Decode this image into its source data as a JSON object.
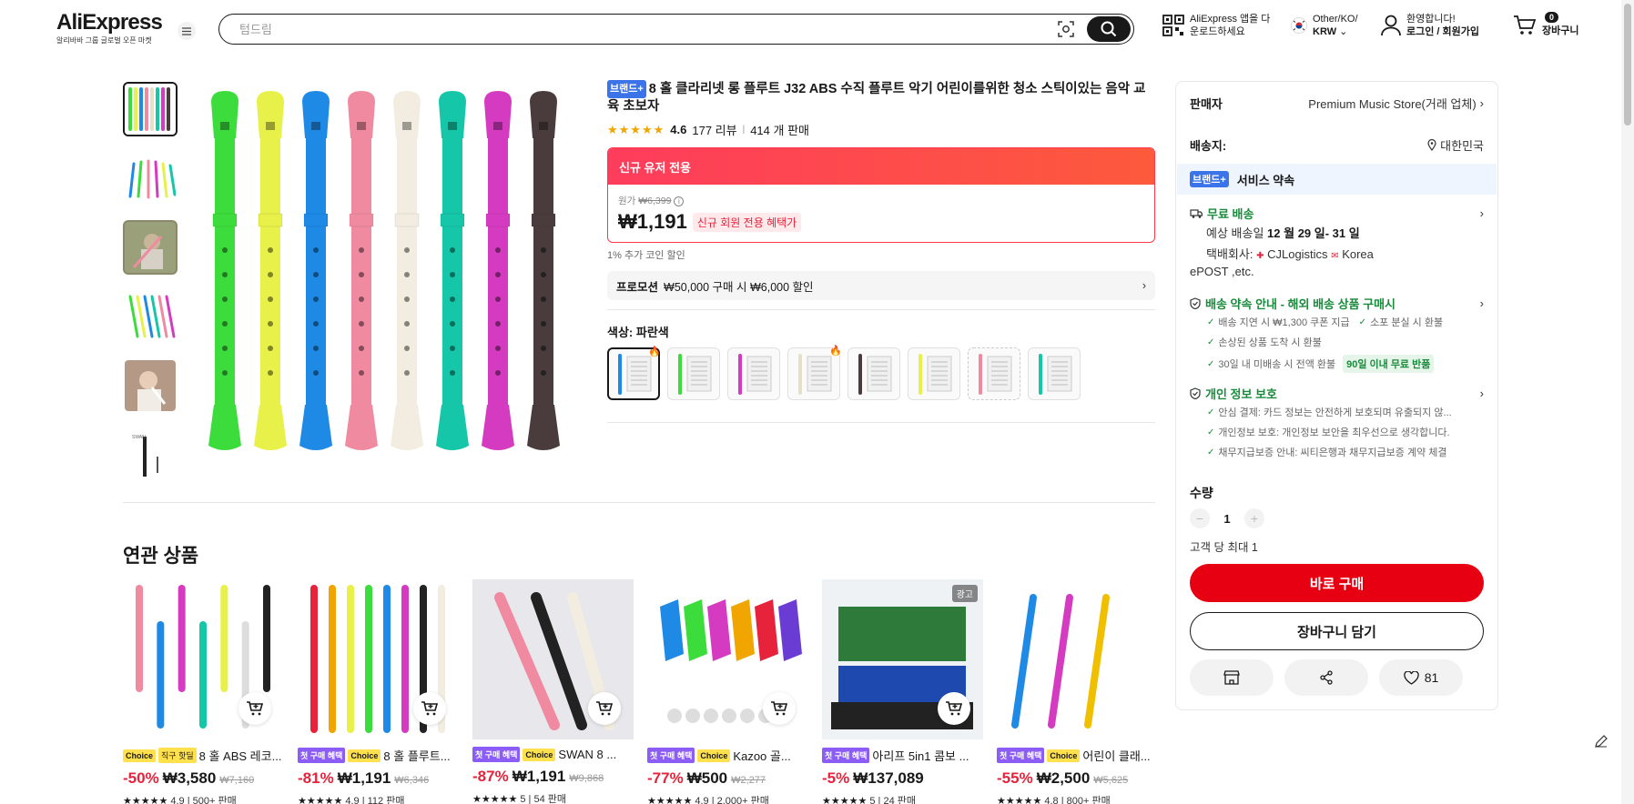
{
  "header": {
    "logo_text": "AliExpress",
    "tagline": "알리바바 그룹 글로벌 오픈 마켓",
    "search_placeholder": "텀드림",
    "app_line1": "AliExpress 앱을 다",
    "app_line2": "운로드하세요",
    "locale_line1": "Other/KO/",
    "locale_line2": "KRW",
    "account_line1": "환영합니다!",
    "account_line2": "로그인 / 회원가입",
    "cart_count": "0",
    "cart_label": "장바구니"
  },
  "product": {
    "brand_badge": "브랜드+",
    "title": "8 홀 클라리넷 롱 플루트 J32 ABS 수직 플루트 악기 어린이를위한 청소 스틱이있는 음악 교육 초보자",
    "stars": "★★★★★",
    "rating": "4.6",
    "reviews": "177 리뷰",
    "sold": "414 개 판매",
    "deal_header": "신규 유저 전용",
    "original_label": "원가",
    "original_price": "₩6,399",
    "price": "₩1,191",
    "price_tag": "신규 회원 전용 혜택가",
    "coin_text": "1% 추가 코인 할인",
    "promo_label": "프로모션",
    "promo_text": "₩50,000 구매 시 ₩6,000 할인",
    "color_label": "색상: 파란색"
  },
  "panel": {
    "seller_label": "판매자",
    "seller_value": "Premium Music Store(거래 업체)",
    "ship_to_label": "배송지:",
    "ship_to_value": "대한민국",
    "service_badge": "브랜드+",
    "service_title": "서비스 약속",
    "free_shipping": "무료 배송",
    "delivery_prefix": "예상 배송일",
    "delivery_dates": "12 월 29 일- 31 일",
    "carrier_label": "택배회사:",
    "carrier_1": "CJLogistics",
    "carrier_2": "Korea",
    "carrier_3": "ePOST ,etc.",
    "promise_title": "배송 약속 안내 - 해외 배송 상품 구매시",
    "promise_1": "배송 지연 시 ₩1,300 쿠폰 지급",
    "promise_2": "소포 분실 시 환불",
    "promise_3": "손상된 상품 도착 시 환불",
    "promise_4": "30일 내 미배송 시 전액 환불",
    "promise_tag": "90일 이내 무료 반품",
    "privacy_title": "개인 정보 보호",
    "privacy_1": "안심 결제: 카드 정보는 안전하게 보호되며 유출되지 않...",
    "privacy_2": "개인정보 보호: 개인정보 보안을 최우선으로 생각합니다.",
    "privacy_3": "채무지급보증 안내: 씨티은행과 채무지급보증 계약 체결",
    "qty_label": "수량",
    "qty_minus": "−",
    "qty_value": "1",
    "qty_plus": "+",
    "limit_text": "고객 당 최대 1",
    "buy_now": "바로 구매",
    "add_to_cart": "장바구니 담기",
    "wishlist_count": "81"
  },
  "related": {
    "title": "연관 상품",
    "items": [
      {
        "badges": [
          "Choice",
          "직구 핫딜"
        ],
        "name": "8 홀 ABS 레코...",
        "discount": "-50%",
        "price": "₩3,580",
        "orig": "₩7,160",
        "stars": "★★★★★",
        "rating": "4.9",
        "sold": "500+ 판매",
        "ad": ""
      },
      {
        "badges": [
          "첫 구매 혜택",
          "Choice"
        ],
        "name": "8 홀 플루트...",
        "discount": "-81%",
        "price": "₩1,191",
        "orig": "₩6,346",
        "stars": "★★★★★",
        "rating": "4.9",
        "sold": "112 판매",
        "ad": ""
      },
      {
        "badges": [
          "첫 구매 혜택",
          "Choice"
        ],
        "name": "SWAN 8 ...",
        "discount": "-87%",
        "price": "₩1,191",
        "orig": "₩9,868",
        "stars": "★★★★★",
        "rating": "5",
        "sold": "54 판매",
        "ad": ""
      },
      {
        "badges": [
          "첫 구매 혜택",
          "Choice"
        ],
        "name": "Kazoo 골...",
        "discount": "-77%",
        "price": "₩500",
        "orig": "₩2,277",
        "stars": "★★★★★",
        "rating": "4.9",
        "sold": "2,000+ 판매",
        "ad": ""
      },
      {
        "badges": [
          "첫 구매 혜택"
        ],
        "name": "아리프 5in1 콤보 ...",
        "discount": "-5%",
        "price": "₩137,089",
        "orig": "",
        "stars": "★★★★★",
        "rating": "5",
        "sold": "24 판매",
        "ad": "광고"
      },
      {
        "badges": [
          "첫 구매 혜택",
          "Choice"
        ],
        "name": "어린이 클래...",
        "discount": "-55%",
        "price": "₩2,500",
        "orig": "₩5,625",
        "stars": "★★★★★",
        "rating": "4.8",
        "sold": "800+ 판매",
        "ad": ""
      }
    ]
  },
  "colors": {
    "accent_red": "#e60012",
    "deal_red": "#fd384f",
    "green": "#1a8b3c",
    "brand_blue": "#3b73e8",
    "recorders": [
      "#3ddc3d",
      "#e8f04a",
      "#1e8ae6",
      "#f08aa0",
      "#f2ede0",
      "#16c6a8",
      "#d43bc0",
      "#4a3c3c"
    ]
  }
}
